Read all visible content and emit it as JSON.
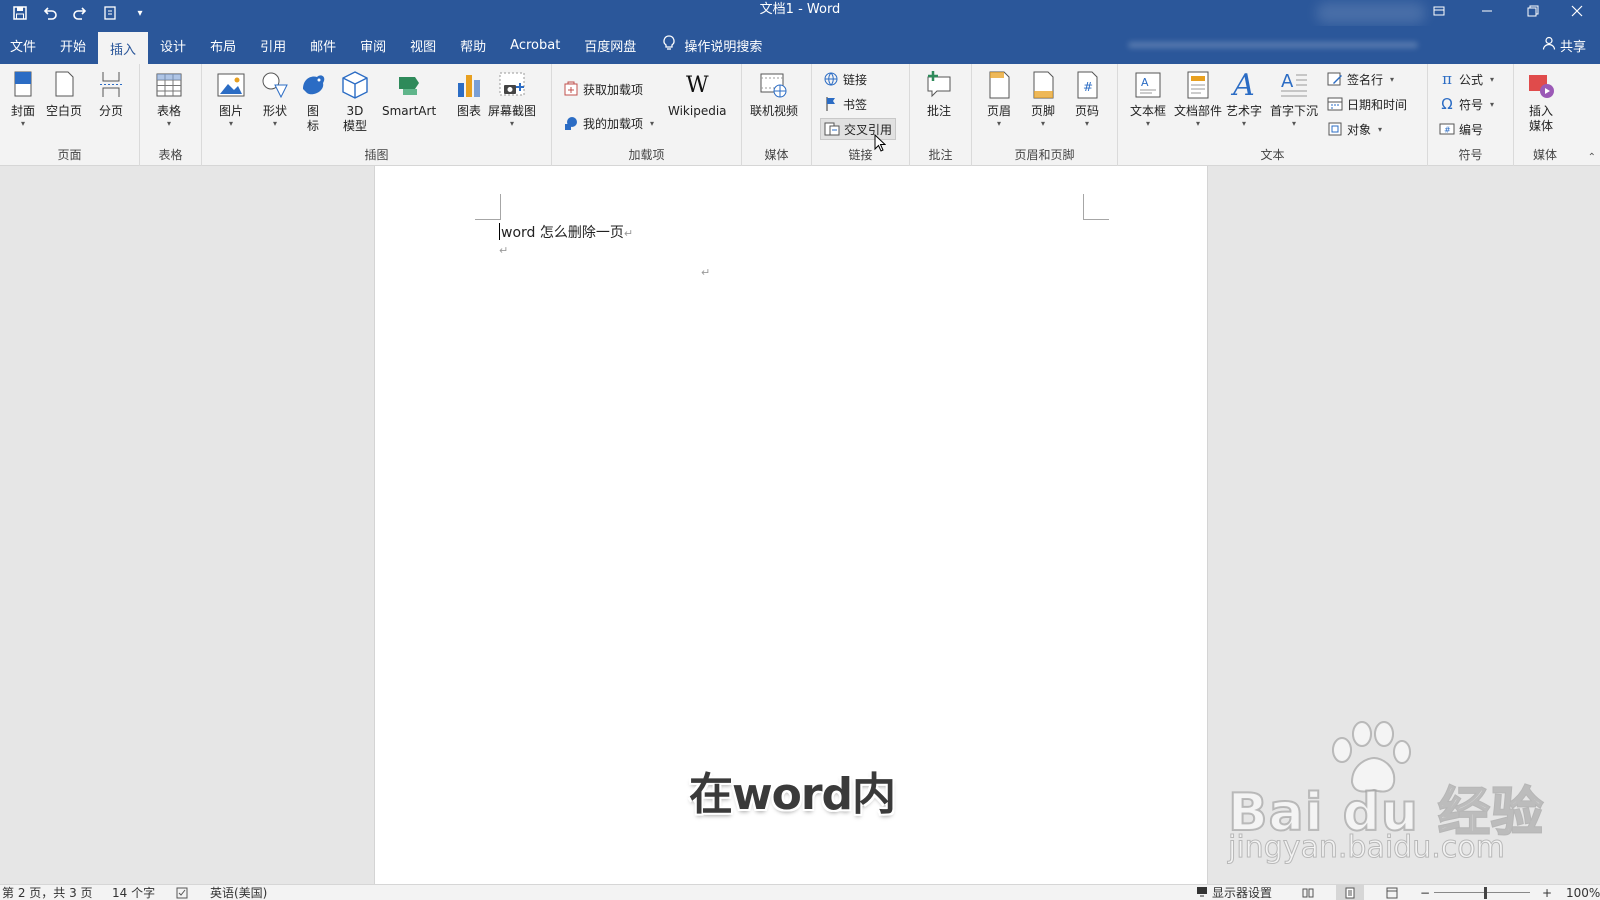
{
  "window": {
    "title": "文档1  -  Word"
  },
  "qat": {
    "icons": [
      "save-icon",
      "undo-icon",
      "redo-icon",
      "touch-mode-icon",
      "customize-qat-icon"
    ]
  },
  "tabs": [
    "文件",
    "开始",
    "插入",
    "设计",
    "布局",
    "引用",
    "邮件",
    "审阅",
    "视图",
    "帮助",
    "Acrobat",
    "百度网盘"
  ],
  "active_tab": "插入",
  "tellme": {
    "label": "操作说明搜索"
  },
  "share": {
    "label": "共享"
  },
  "ribbon": {
    "pages": {
      "label": "页面",
      "items": [
        "封面",
        "空白页",
        "分页"
      ]
    },
    "tables": {
      "label": "表格",
      "items": [
        "表格"
      ]
    },
    "illustrations": {
      "label": "插图",
      "items": [
        "图片",
        "形状",
        "图\n标",
        "3D\n模型",
        "SmartArt",
        "图表",
        "屏幕截图"
      ]
    },
    "addins": {
      "label": "加载项",
      "get": "获取加载项",
      "my": "我的加载项",
      "wikipedia": "Wikipedia"
    },
    "media": {
      "label": "媒体",
      "items": [
        "联机视频"
      ]
    },
    "links": {
      "label": "链接",
      "items": [
        "链接",
        "书签",
        "交叉引用"
      ]
    },
    "comments": {
      "label": "批注",
      "items": [
        "批注"
      ]
    },
    "header_footer": {
      "label": "页眉和页脚",
      "items": [
        "页眉",
        "页脚",
        "页码"
      ]
    },
    "text": {
      "label": "文本",
      "items": [
        "文本框",
        "文档部件",
        "艺术字",
        "首字下沉"
      ],
      "small": [
        "签名行",
        "日期和时间",
        "对象"
      ]
    },
    "symbols": {
      "label": "符号",
      "items": [
        "公式",
        "符号",
        "编号"
      ]
    },
    "media2": {
      "label": "媒体",
      "items": [
        "插入\n媒体"
      ]
    }
  },
  "document": {
    "line1": "word 怎么删除一页",
    "para_mark": "↵"
  },
  "subtitle": "在word内",
  "watermark": {
    "main": "Bai du 经验",
    "sub": "jingyan.baidu.com"
  },
  "status": {
    "page": "第 2 页，共 3 页",
    "words": "14 个字",
    "language": "英语(美国)",
    "display": "显示器设置",
    "zoom": "100%"
  },
  "colors": {
    "brand": "#2b579a",
    "ribbon": "#f3f3f3",
    "canvas": "#e6e6e6"
  }
}
